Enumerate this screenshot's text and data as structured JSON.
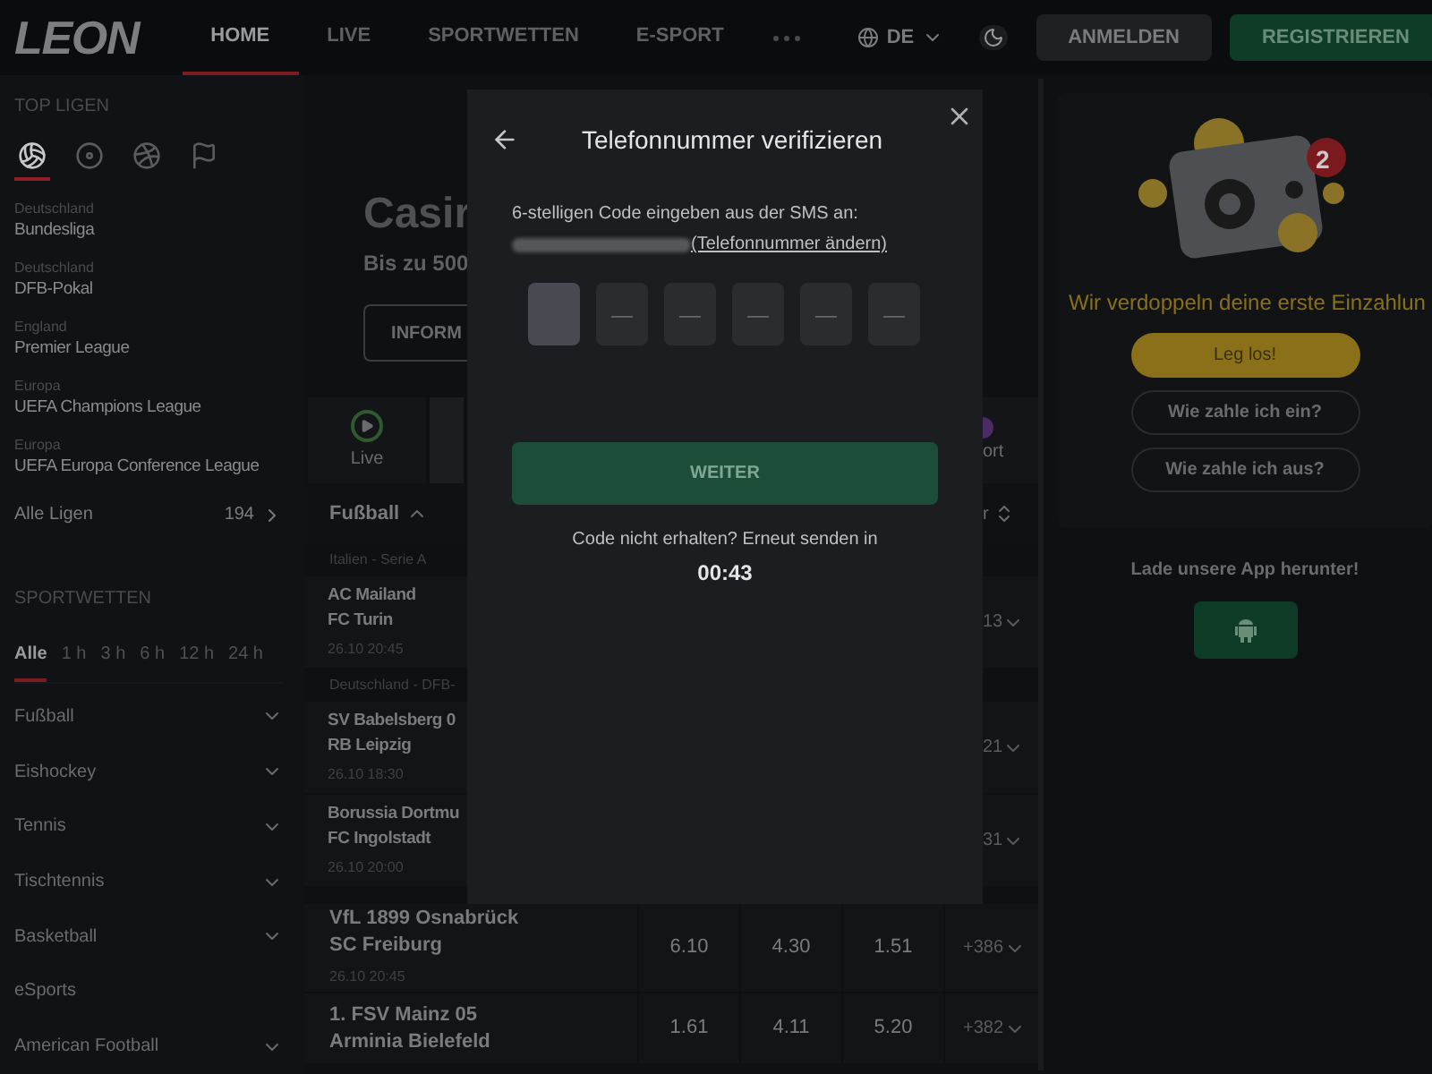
{
  "header": {
    "logo": "LEON",
    "nav": [
      {
        "label": "HOME",
        "selected": true
      },
      {
        "label": "LIVE",
        "selected": false
      },
      {
        "label": "SPORTWETTEN",
        "selected": false
      },
      {
        "label": "E-SPORT",
        "selected": false
      }
    ],
    "language": "DE",
    "dark_mode": true,
    "login": "ANMELDEN",
    "register": "REGISTRIEREN"
  },
  "sidebar": {
    "top_title": "TOP LIGEN",
    "sport_icons": [
      {
        "kind": "soccer",
        "selected": true
      },
      {
        "kind": "hockey",
        "selected": false
      },
      {
        "kind": "basketball",
        "selected": false
      },
      {
        "kind": "racing",
        "selected": false
      }
    ],
    "leagues": [
      {
        "country": "Deutschland",
        "name": "Bundesliga"
      },
      {
        "country": "Deutschland",
        "name": "DFB-Pokal"
      },
      {
        "country": "England",
        "name": "Premier League"
      },
      {
        "country": "Europa",
        "name": "UEFA Champions League"
      },
      {
        "country": "Europa",
        "name": "UEFA Europa Conference League"
      }
    ],
    "all_leagues": {
      "label": "Alle Ligen",
      "count": "194"
    },
    "bets_title": "SPORTWETTEN",
    "time_filters": [
      {
        "label": "Alle",
        "selected": true
      },
      {
        "label": "1 h",
        "selected": false
      },
      {
        "label": "3 h",
        "selected": false
      },
      {
        "label": "6 h",
        "selected": false
      },
      {
        "label": "12 h",
        "selected": false
      },
      {
        "label": "24 h",
        "selected": false
      }
    ],
    "sports": [
      {
        "label": "Fußball",
        "expandable": true
      },
      {
        "label": "Eishockey",
        "expandable": true
      },
      {
        "label": "Tennis",
        "expandable": true
      },
      {
        "label": "Tischtennis",
        "expandable": true
      },
      {
        "label": "Basketball",
        "expandable": true
      },
      {
        "label": "eSports",
        "expandable": false
      },
      {
        "label": "American Football",
        "expandable": true
      }
    ]
  },
  "main": {
    "banner": {
      "title": "Casir",
      "subtitle": "Bis zu 500",
      "button": "INFORM"
    },
    "live_tab": "Live",
    "esport_tab": "ort",
    "section": "Fußball",
    "sort": "r",
    "groups": [
      {
        "league": "Italien - Serie A",
        "matches": [
          {
            "home": "AC Mailand",
            "away": "FC Turin",
            "time": "26.10 20:45",
            "more": "13"
          }
        ]
      },
      {
        "league": "Deutschland - DFB-",
        "matches": [
          {
            "home": "SV Babelsberg 0",
            "away": "RB Leipzig",
            "time": "26.10 18:30",
            "more": "21"
          },
          {
            "home": "Borussia Dortmu",
            "away": "FC Ingolstadt",
            "time": "26.10 20:00",
            "more": "31"
          }
        ]
      }
    ],
    "full_matches": [
      {
        "home": "VfL 1899 Osnabrück",
        "away": "SC Freiburg",
        "time": "26.10 20:45",
        "odds": [
          "6.10",
          "4.30",
          "1.51"
        ],
        "more": "+386"
      },
      {
        "home": "1. FSV Mainz 05",
        "away": "Arminia Bielefeld",
        "odds": [
          "1.61",
          "4.11",
          "5.20"
        ],
        "more": "+382"
      }
    ]
  },
  "promo": {
    "badge": "2",
    "headline": "Wir verdoppeln deine erste Einzahlun",
    "cta": "Leg los!",
    "links": [
      "Wie zahle ich ein?",
      "Wie zahle ich aus?"
    ],
    "app_title": "Lade unsere App herunter!"
  },
  "dialog": {
    "title": "Telefonnummer verifizieren",
    "instruction": "6-stelligen Code eingeben aus der SMS an:",
    "change_link": "(Telefonnummer ändern)",
    "placeholder": "—",
    "boxes": [
      {
        "active": true
      },
      {
        "active": false
      },
      {
        "active": false
      },
      {
        "active": false
      },
      {
        "active": false
      },
      {
        "active": false
      }
    ],
    "submit": {
      "label": "WEITER",
      "disabled": true
    },
    "resend": "Code nicht erhalten? Erneut senden in",
    "countdown": "00:43"
  }
}
